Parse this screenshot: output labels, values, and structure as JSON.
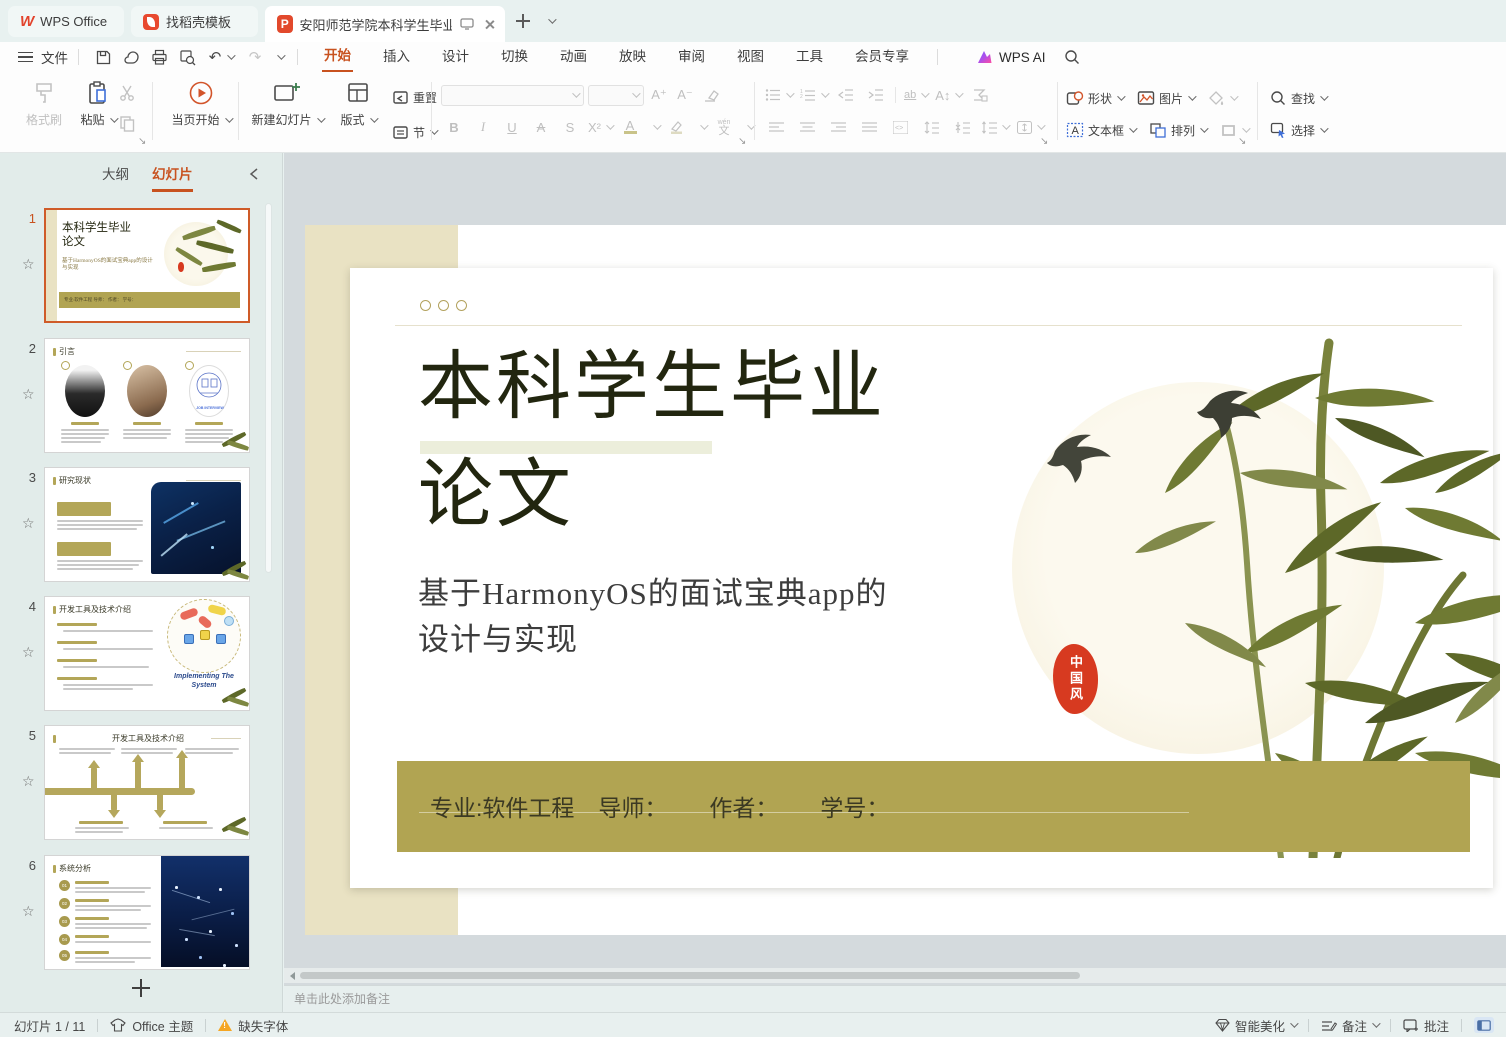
{
  "tabbar": {
    "home_tab": "WPS Office",
    "docer_tab": "找稻壳模板",
    "doc_tab": "安阳师范学院本科学生毕业论文"
  },
  "menu": {
    "file": "文件",
    "items": [
      "开始",
      "插入",
      "设计",
      "切换",
      "动画",
      "放映",
      "审阅",
      "视图",
      "工具",
      "会员专享"
    ],
    "wps_ai": "WPS AI"
  },
  "ribbon": {
    "format_painter": "格式刷",
    "paste": "粘贴",
    "play_current": "当页开始",
    "new_slide": "新建幻灯片",
    "layout": "版式",
    "reset": "重置",
    "section": "节",
    "shapes": "形状",
    "picture": "图片",
    "text_box": "文本框",
    "arrange": "排列",
    "find": "查找",
    "select": "选择"
  },
  "sidebar": {
    "tab_outline": "大纲",
    "tab_slides": "幻灯片",
    "slides": [
      {
        "num": "1",
        "title_l1": "本科学生毕业",
        "title_l2": "论文",
        "subtitle": "基于HarmonyOS的面试宝典app的设计与实现",
        "footer": "专业:软件工程 导师： 作者： 学号：",
        "seal": "中"
      },
      {
        "num": "2",
        "title": "引言",
        "oval3_label": "JOB INTERVIEW"
      },
      {
        "num": "3",
        "title": "研究现状"
      },
      {
        "num": "4",
        "title": "开发工具及技术介绍",
        "illustration_label": "Implementing The System"
      },
      {
        "num": "5",
        "title": "开发工具及技术介绍"
      },
      {
        "num": "6",
        "title": "系统分析",
        "items": [
          "01",
          "02",
          "03",
          "04",
          "05"
        ]
      }
    ]
  },
  "slide": {
    "title_l1": "本科学生毕业",
    "title_l2": "论文",
    "subtitle_l1": "基于HarmonyOS的面试宝典app的",
    "subtitle_l2": "设计与实现",
    "info": {
      "major": "专业:软件工程",
      "advisor": "导师：",
      "author": "作者：",
      "student_id": "学号："
    },
    "seal": "中国风"
  },
  "notes": {
    "placeholder": "单击此处添加备注"
  },
  "statusbar": {
    "slide_counter": "幻灯片 1 / 11",
    "theme": "Office 主题",
    "missing_fonts": "缺失字体",
    "beautify": "智能美化",
    "notes_label": "备注",
    "comments_label": "批注"
  },
  "colors": {
    "accent_orange": "#c8521f",
    "wps_red": "#e2432c",
    "olive_bar": "#b1a452",
    "slide_tan": "#e9e2c3",
    "title_ink": "#22260f",
    "seal_red": "#d73a20"
  }
}
